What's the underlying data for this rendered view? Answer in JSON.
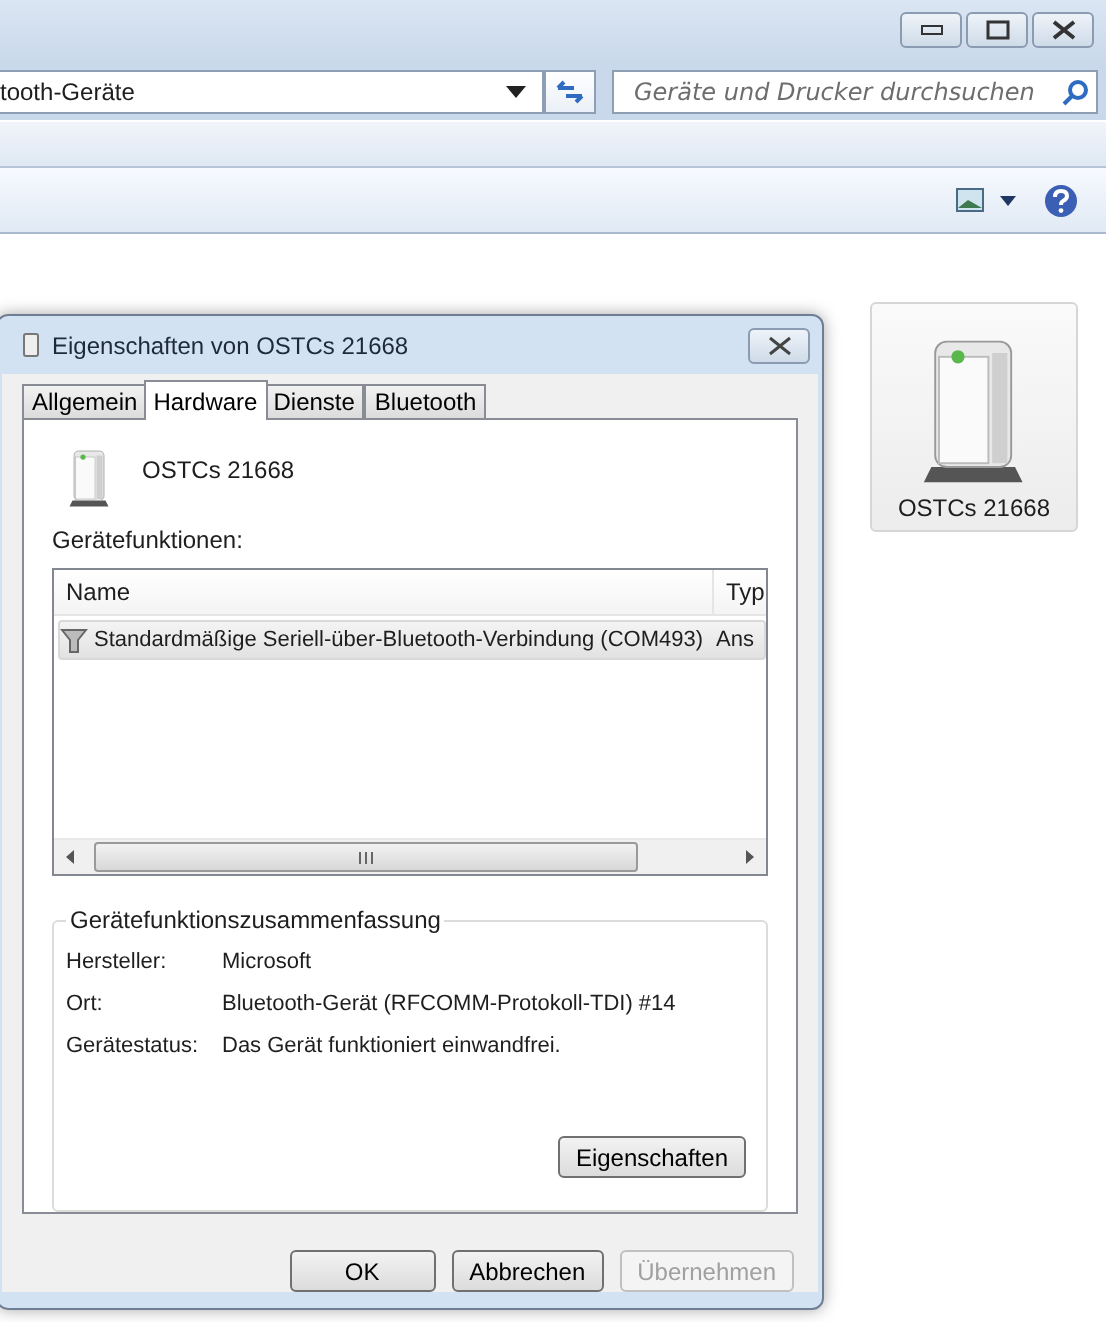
{
  "explorer": {
    "address": "tooth-Geräte",
    "search": {
      "placeholder": "Geräte und Drucker durchsuchen"
    },
    "devices": [
      {
        "name": "OSTCs 21668",
        "selected": true
      }
    ]
  },
  "dialog": {
    "title": "Eigenschaften von OSTCs 21668",
    "tabs": [
      {
        "label": "Allgemein",
        "selected": false
      },
      {
        "label": "Hardware",
        "selected": true
      },
      {
        "label": "Dienste",
        "selected": false
      },
      {
        "label": "Bluetooth",
        "selected": false
      }
    ],
    "device_name": "OSTCs 21668",
    "functions_label": "Gerätefunktionen:",
    "table": {
      "columns": [
        "Name",
        "Typ"
      ],
      "rows": [
        {
          "cells": [
            "Standardmäßige Seriell-über-Bluetooth-Verbindung (COM493)",
            "Ans"
          ],
          "selected": true
        }
      ]
    },
    "summary": {
      "title": "Gerätefunktionszusammenfassung",
      "fields": [
        {
          "label": "Hersteller:",
          "value": "Microsoft"
        },
        {
          "label": "Ort:",
          "value": "Bluetooth-Gerät (RFCOMM-Protokoll-TDI) #14"
        },
        {
          "label": "Gerätestatus:",
          "value": "Das Gerät funktioniert einwandfrei."
        }
      ],
      "button": "Eigenschaften"
    },
    "buttons": [
      {
        "label": "OK",
        "disabled": false
      },
      {
        "label": "Abbrechen",
        "disabled": false
      },
      {
        "label": "Übernehmen",
        "disabled": true
      }
    ]
  }
}
